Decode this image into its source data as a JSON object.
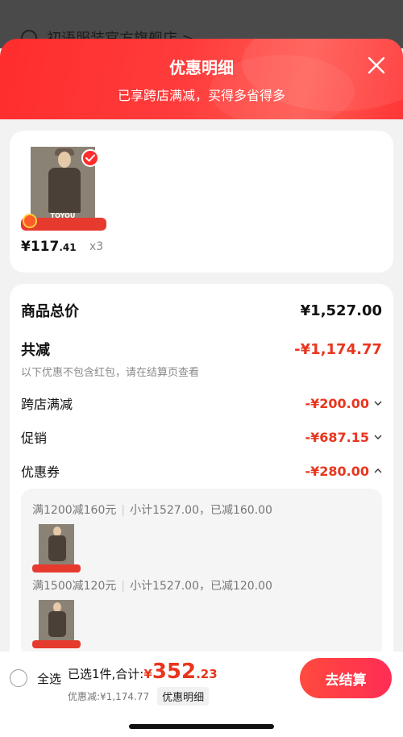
{
  "background": {
    "shop_name": "初语服装官方旗舰店 >"
  },
  "header": {
    "title": "优惠明细",
    "subtitle": "已享跨店满减，买得多省得多",
    "close_icon": "close-icon"
  },
  "product": {
    "brand": "TOYOU",
    "price_int": "¥117",
    "price_dec": ".41",
    "quantity": "x3",
    "badge_icon": "check-icon"
  },
  "breakdown": {
    "total_label": "商品总价",
    "total_value": "¥1,527.00",
    "reduce_label": "共减",
    "reduce_value": "-¥1,174.77",
    "note": "以下优惠不包含红包，请在结算页查看",
    "items": [
      {
        "label": "跨店满减",
        "value": "-¥200.00",
        "expanded": false
      },
      {
        "label": "促销",
        "value": "-¥687.15",
        "expanded": false
      },
      {
        "label": "优惠券",
        "value": "-¥280.00",
        "expanded": true
      }
    ],
    "coupons": [
      {
        "rule": "满1200减160元",
        "detail": "小计1527.00，已减160.00"
      },
      {
        "rule": "满1500减120元",
        "detail": "小计1527.00，已减120.00"
      }
    ]
  },
  "bottom_bar": {
    "select_all": "全选",
    "selected_text": "已选1件,合计:",
    "total_symbol": "¥",
    "total_int": "352",
    "total_dec": ".23",
    "discount_text": "优惠减:¥1,174.77",
    "detail_link": "优惠明细",
    "checkout": "去结算"
  },
  "colors": {
    "accent": "#ff2d2d",
    "price_red": "#e8361e"
  }
}
